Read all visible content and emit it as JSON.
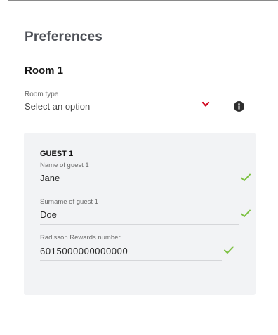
{
  "preferences": {
    "title": "Preferences",
    "room": {
      "title": "Room 1",
      "room_type": {
        "label": "Room type",
        "value": "Select an option",
        "chevron_icon": "chevron-down-icon",
        "chevron_color": "#d0021b",
        "info_icon": "info-icon"
      }
    },
    "guest": {
      "heading": "GUEST 1",
      "fields": [
        {
          "label": "Name of guest 1",
          "value": "Jane",
          "status_icon": "checkmark-icon"
        },
        {
          "label": "Surname of guest 1",
          "value": "Doe",
          "status_icon": "checkmark-icon"
        },
        {
          "label": "Radisson Rewards number",
          "value": "6015000000000000",
          "status_icon": "checkmark-icon"
        }
      ],
      "check_color": "#7dc142"
    }
  }
}
